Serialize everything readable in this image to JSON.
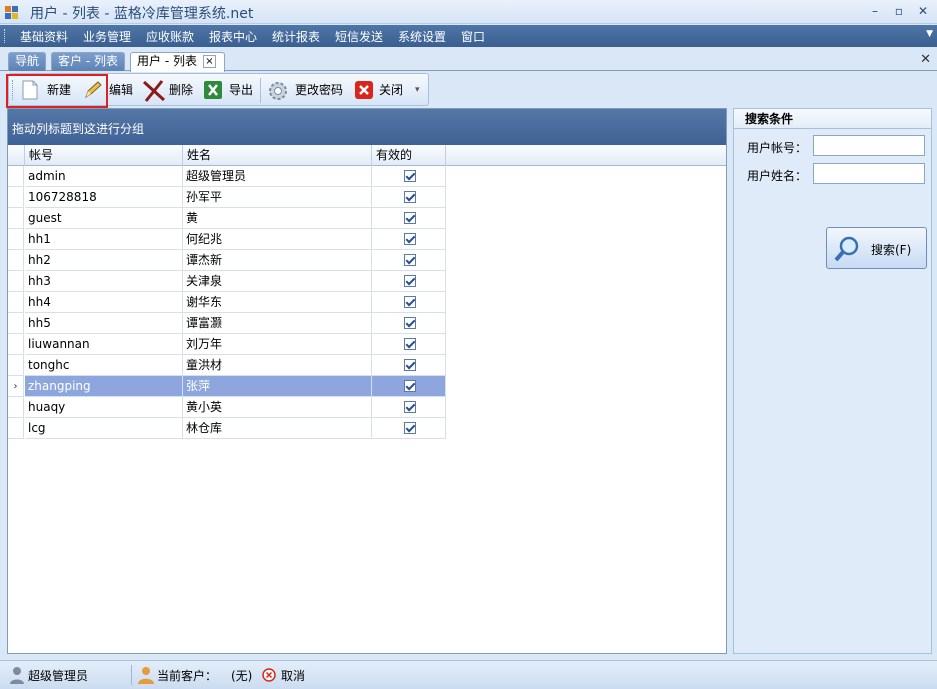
{
  "window": {
    "title": "用户 - 列表 - 蓝格冷库管理系统.net",
    "minimize": "–",
    "maximize": "▫",
    "close": "✕"
  },
  "menu": [
    "基础资料",
    "业务管理",
    "应收账款",
    "报表中心",
    "统计报表",
    "短信发送",
    "系统设置",
    "窗口"
  ],
  "tabs": [
    {
      "label": "导航"
    },
    {
      "label": "客户 - 列表"
    },
    {
      "label": "用户 - 列表",
      "close": "×"
    }
  ],
  "toolbar": {
    "new": "新建",
    "edit": "编辑",
    "delete": "删除",
    "export": "导出",
    "change_password": "更改密码",
    "close": "关闭"
  },
  "grid": {
    "group_hint": "拖动列标题到这进行分组",
    "columns": [
      "帐号",
      "姓名",
      "有效的"
    ],
    "selected_index": 10,
    "rows": [
      {
        "account": "admin",
        "name": "超级管理员",
        "valid": true
      },
      {
        "account": "106728818",
        "name": "孙军平",
        "valid": true
      },
      {
        "account": "guest",
        "name": "黄",
        "valid": true
      },
      {
        "account": "hh1",
        "name": "何纪兆",
        "valid": true
      },
      {
        "account": "hh2",
        "name": "谭杰新",
        "valid": true
      },
      {
        "account": "hh3",
        "name": "关津泉",
        "valid": true
      },
      {
        "account": "hh4",
        "name": "谢华东",
        "valid": true
      },
      {
        "account": "hh5",
        "name": "谭富灏",
        "valid": true
      },
      {
        "account": "liuwannan",
        "name": "刘万年",
        "valid": true
      },
      {
        "account": "tonghc",
        "name": "童洪材",
        "valid": true
      },
      {
        "account": "zhangping",
        "name": "张萍",
        "valid": true
      },
      {
        "account": "huaqy",
        "name": "黄小英",
        "valid": true
      },
      {
        "account": "lcg",
        "name": "林仓库",
        "valid": true
      }
    ]
  },
  "search": {
    "title": "搜索条件",
    "account_label": "用户帐号：",
    "name_label": "用户姓名：",
    "account_value": "",
    "name_value": "",
    "button": "搜索(F)"
  },
  "status": {
    "user": "超级管理员",
    "current_customer_label": "当前客户：",
    "current_customer_value": "(无)",
    "cancel": "取消"
  },
  "colors": {
    "menubar": "#3a5f91",
    "groupbar": "#4a6c9e",
    "selected_row": "#8da6dd",
    "highlight_box": "#e02020"
  }
}
